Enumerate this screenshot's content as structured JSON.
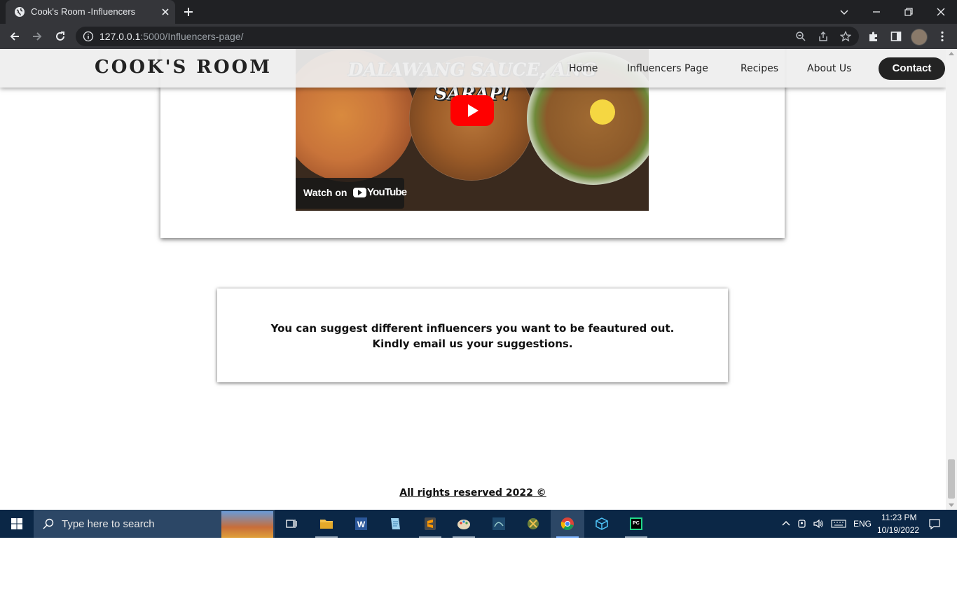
{
  "browser": {
    "tab_title": "Cook's Room -Influencers",
    "url_host": "127.0.0.1",
    "url_rest": ":5000/Influencers-page/"
  },
  "site": {
    "logo": "COOK'S ROOM",
    "nav": [
      "Home",
      "Influencers Page",
      "Recipes",
      "About Us"
    ],
    "contact": "Contact"
  },
  "video": {
    "title": "DALAWANG SAUCE, ANG SARAP!",
    "watch_on": "Watch on",
    "youtube": "YouTube"
  },
  "suggest": {
    "line1": "You can suggest different influencers you want to be feautured out.",
    "line2": "Kindly email us your suggestions."
  },
  "footer": "All rights reserved 2022 ©",
  "taskbar": {
    "search_placeholder": "Type here to search",
    "lang": "ENG",
    "time": "11:23 PM",
    "date": "10/19/2022"
  },
  "colors": {
    "accent_button": "#232323",
    "taskbar": "#0b2746",
    "youtube_red": "#ff0000"
  }
}
